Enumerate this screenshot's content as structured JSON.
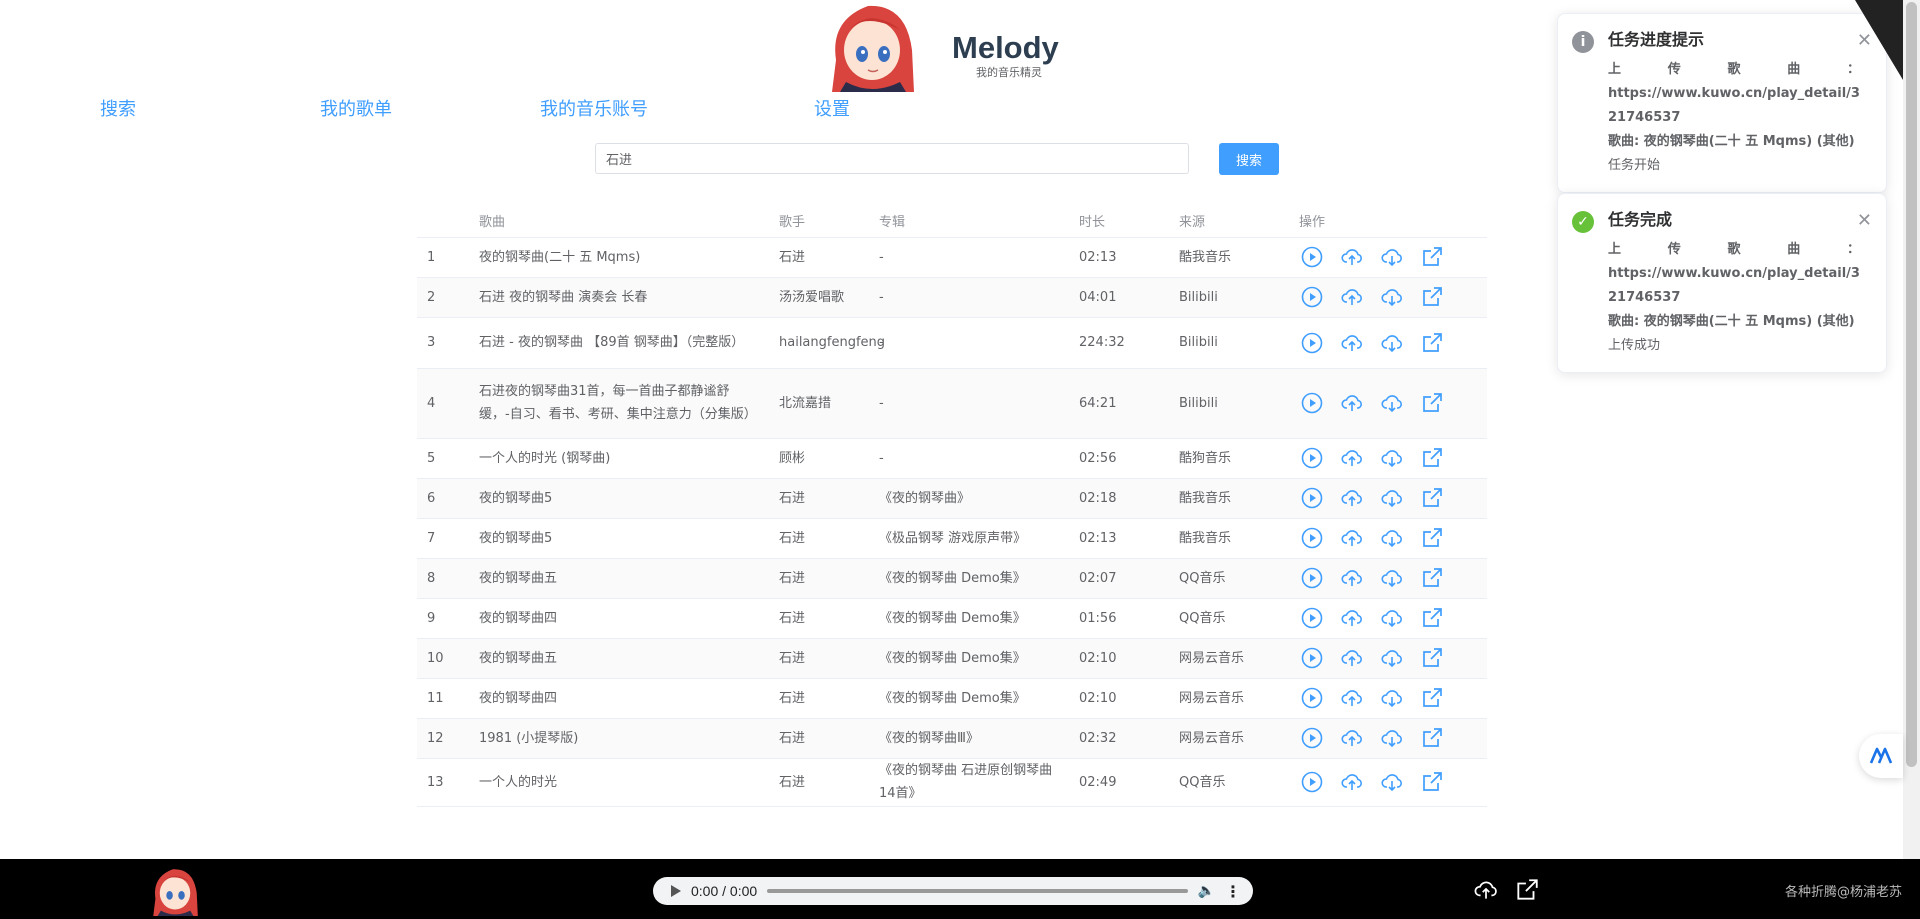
{
  "brand": {
    "title": "Melody",
    "subtitle": "我的音乐精灵"
  },
  "nav": {
    "search": "搜索",
    "playlists": "我的歌单",
    "account": "我的音乐账号",
    "settings": "设置"
  },
  "search": {
    "query": "石进",
    "button": "搜索"
  },
  "table": {
    "headers": {
      "index": "",
      "song": "歌曲",
      "artist": "歌手",
      "album": "专辑",
      "duration": "时长",
      "source": "来源",
      "actions": "操作"
    },
    "rows": [
      {
        "index": "1",
        "song": "夜的钢琴曲(二十 五 Mqms)",
        "artist": "石进",
        "album": "-",
        "duration": "02:13",
        "source": "酷我音乐"
      },
      {
        "index": "2",
        "song": "石进 夜的钢琴曲 演奏会 长春",
        "artist": "汤汤爱唱歌",
        "album": "-",
        "duration": "04:01",
        "source": "Bilibili"
      },
      {
        "index": "3",
        "song": "石进 - 夜的钢琴曲 【89首 钢琴曲】（完整版）",
        "artist": "hailangfengfeng",
        "album": "-",
        "duration": "224:32",
        "source": "Bilibili"
      },
      {
        "index": "4",
        "song": "石进夜的钢琴曲31首，每一首曲子都静谧舒缓，-自习、看书、考研、集中注意力（分集版）",
        "artist": "北流嘉措",
        "album": "-",
        "duration": "64:21",
        "source": "Bilibili"
      },
      {
        "index": "5",
        "song": "一个人的时光 (钢琴曲)",
        "artist": "顾彬",
        "album": "-",
        "duration": "02:56",
        "source": "酷狗音乐"
      },
      {
        "index": "6",
        "song": "夜的钢琴曲5",
        "artist": "石进",
        "album": "《夜的钢琴曲》",
        "duration": "02:18",
        "source": "酷我音乐"
      },
      {
        "index": "7",
        "song": "夜的钢琴曲5",
        "artist": "石进",
        "album": "《极品钢琴 游戏原声带》",
        "duration": "02:13",
        "source": "酷我音乐"
      },
      {
        "index": "8",
        "song": "夜的钢琴曲五",
        "artist": "石进",
        "album": "《夜的钢琴曲 Demo集》",
        "duration": "02:07",
        "source": "QQ音乐"
      },
      {
        "index": "9",
        "song": "夜的钢琴曲四",
        "artist": "石进",
        "album": "《夜的钢琴曲 Demo集》",
        "duration": "01:56",
        "source": "QQ音乐"
      },
      {
        "index": "10",
        "song": "夜的钢琴曲五",
        "artist": "石进",
        "album": "《夜的钢琴曲 Demo集》",
        "duration": "02:10",
        "source": "网易云音乐"
      },
      {
        "index": "11",
        "song": "夜的钢琴曲四",
        "artist": "石进",
        "album": "《夜的钢琴曲 Demo集》",
        "duration": "02:10",
        "source": "网易云音乐"
      },
      {
        "index": "12",
        "song": "1981 (小提琴版)",
        "artist": "石进",
        "album": "《夜的钢琴曲Ⅲ》",
        "duration": "02:32",
        "source": "网易云音乐"
      },
      {
        "index": "13",
        "song": "一个人的时光",
        "artist": "石进",
        "album": "《夜的钢琴曲 石进原创钢琴曲14首》",
        "duration": "02:49",
        "source": "QQ音乐"
      }
    ]
  },
  "notifications": [
    {
      "type": "info",
      "icon": "info-icon",
      "color": "#909399",
      "title": "任务进度提示",
      "label": "上传歌曲：",
      "url": "https://www.kuwo.cn/play_detail/321746537",
      "song": "歌曲: 夜的钢琴曲(二十 五 Mqms) (其他)",
      "status": "任务开始"
    },
    {
      "type": "success",
      "icon": "check-icon",
      "color": "#67c23a",
      "title": "任务完成",
      "label": "上传歌曲：",
      "url": "https://www.kuwo.cn/play_detail/321746537",
      "song": "歌曲: 夜的钢琴曲(二十 五 Mqms) (其他)",
      "status": "上传成功"
    }
  ],
  "player": {
    "time": "0:00 / 0:00",
    "progress": 0,
    "credit": "各种折腾@杨浦老苏"
  },
  "colors": {
    "accent": "#409eff",
    "success": "#67c23a",
    "player_bg": "#000000"
  }
}
